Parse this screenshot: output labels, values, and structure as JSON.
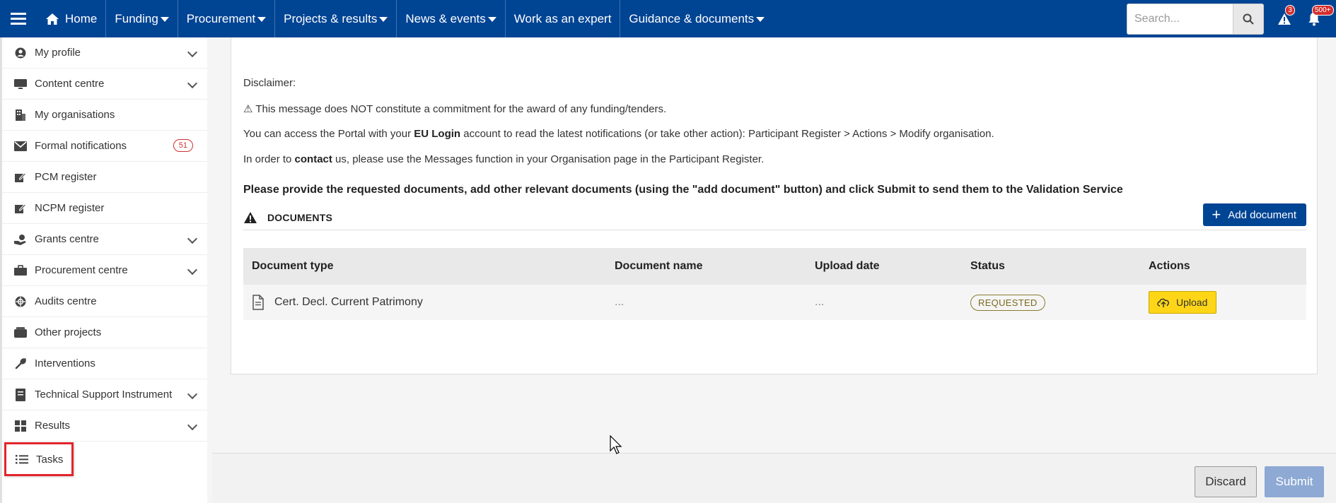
{
  "topnav": {
    "items": [
      {
        "label": "Home"
      },
      {
        "label": "Funding"
      },
      {
        "label": "Procurement"
      },
      {
        "label": "Projects & results"
      },
      {
        "label": "News & events"
      },
      {
        "label": "Work as an expert"
      },
      {
        "label": "Guidance & documents"
      }
    ],
    "search_placeholder": "Search...",
    "alerts_count": "3",
    "notifications_count": "500+"
  },
  "sidebar": {
    "items": [
      {
        "label": "My profile"
      },
      {
        "label": "Content centre"
      },
      {
        "label": "My organisations"
      },
      {
        "label": "Formal notifications",
        "badge": "51"
      },
      {
        "label": "PCM register"
      },
      {
        "label": "NCPM register"
      },
      {
        "label": "Grants centre"
      },
      {
        "label": "Procurement centre"
      },
      {
        "label": "Audits centre"
      },
      {
        "label": "Other projects"
      },
      {
        "label": "Interventions"
      },
      {
        "label": "Technical Support Instrument"
      },
      {
        "label": "Results"
      },
      {
        "label": "Tasks"
      }
    ]
  },
  "main": {
    "disclaimer_heading": "Disclaimer:",
    "line1": "⚠ This message does NOT constitute a commitment for the award of any funding/tenders.",
    "line2_pre": "You can access the Portal with your ",
    "line2_bold": "EU Login",
    "line2_post": " account to read the latest notifications (or take other action): Participant Register > Actions > Modify organisation.",
    "line3_pre": "In order to ",
    "line3_bold": "contact",
    "line3_post": " us, please use the Messages function in your Organisation page in the Participant Register.",
    "instruction": "Please provide the requested documents, add other relevant documents (using the \"add document\" button) and click Submit to send them to the Validation Service",
    "documents_title": "DOCUMENTS",
    "add_document_label": "Add document",
    "table": {
      "headers": [
        "Document type",
        "Document name",
        "Upload date",
        "Status",
        "Actions"
      ],
      "rows": [
        {
          "type": "Cert. Decl. Current Patrimony",
          "name": "...",
          "date": "...",
          "status": "REQUESTED",
          "action": "Upload"
        }
      ]
    }
  },
  "footer": {
    "discard_label": "Discard",
    "submit_label": "Submit"
  },
  "colors": {
    "brand": "#004494",
    "upload": "#ffd617",
    "highlight": "#e3242b"
  }
}
